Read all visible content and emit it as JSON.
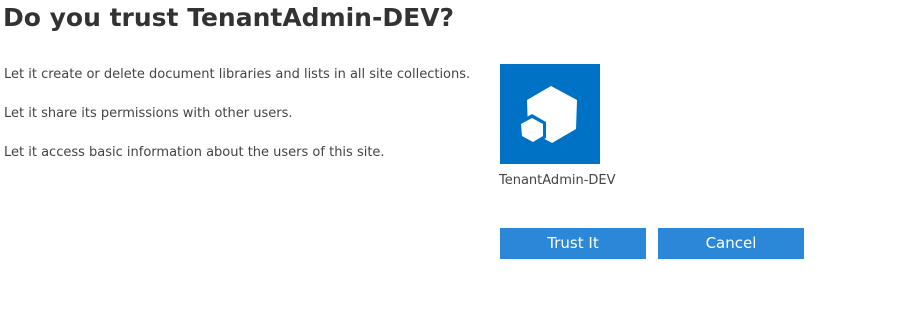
{
  "dialog": {
    "title": "Do you trust TenantAdmin-DEV?",
    "permissions": [
      "Let it create or delete document libraries and lists in all site collections.",
      "Let it share its permissions with other users.",
      "Let it access basic information about the users of this site."
    ],
    "app": {
      "name": "TenantAdmin-DEV",
      "icon": "app-hexagon-icon",
      "tile_color": "#0072c6"
    },
    "buttons": {
      "trust_label": "Trust It",
      "cancel_label": "Cancel",
      "button_color": "#2b88d8"
    }
  }
}
